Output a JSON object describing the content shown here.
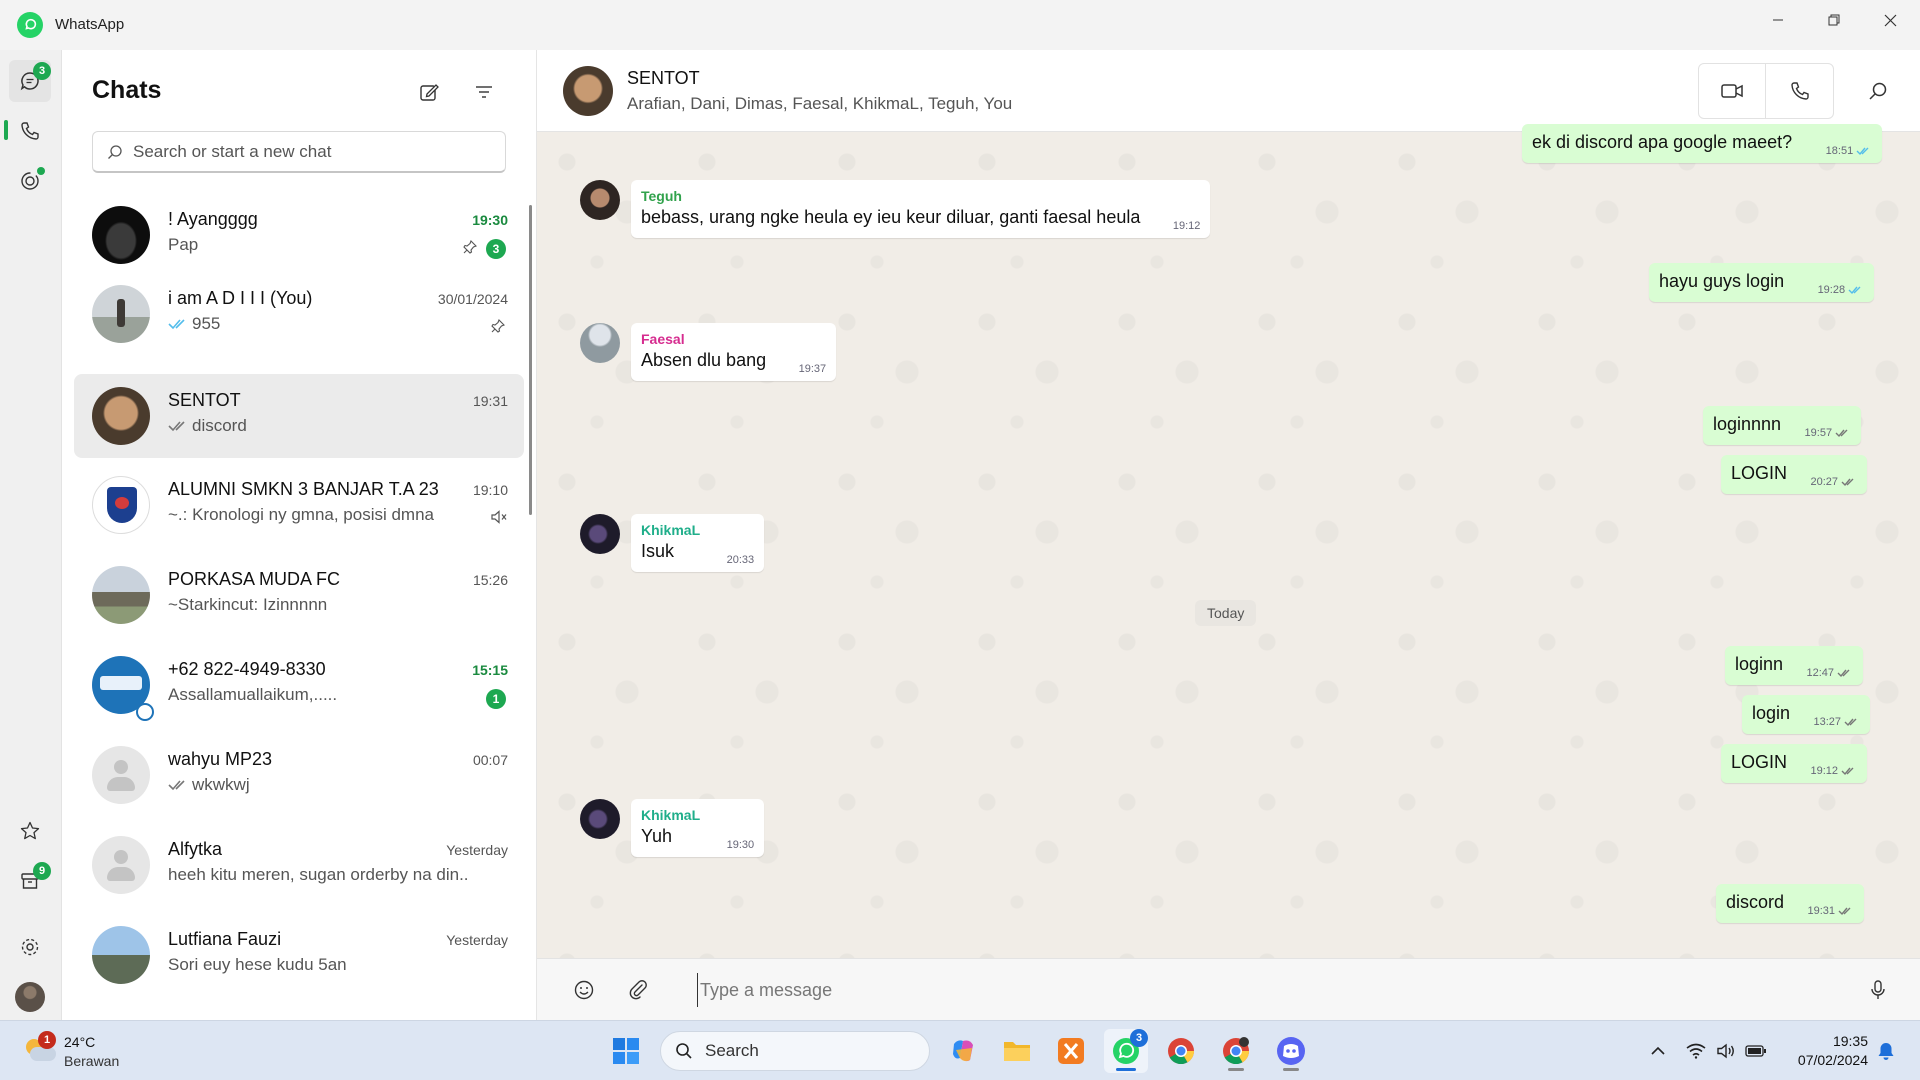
{
  "window": {
    "title": "WhatsApp"
  },
  "rail": {
    "chats_badge": "3",
    "archive_badge": "9"
  },
  "chatlist": {
    "title": "Chats",
    "search_placeholder": "Search or start a new chat",
    "items": [
      {
        "name": "! Ayangggg",
        "preview": "Pap",
        "time": "19:30",
        "unread": "3",
        "pinned": true,
        "ticks": false
      },
      {
        "name": "i am A D I I I (You)",
        "preview": "955",
        "time": "30/01/2024",
        "pinned": true,
        "ticks": "blue"
      },
      {
        "name": "SENTOT",
        "preview": "discord",
        "time": "19:31",
        "ticks": "grey",
        "selected": true
      },
      {
        "name": "ALUMNI SMKN 3 BANJAR T.A 23",
        "preview": "~.: Kronologi ny gmna, posisi dmna",
        "time": "19:10",
        "muted": true
      },
      {
        "name": "PORKASA MUDA FC",
        "preview": "~Starkincut: Izinnnnn",
        "time": "15:26"
      },
      {
        "name": "+62 822-4949-8330",
        "preview": "Assallamuallaikum,.....",
        "time": "15:15",
        "unread": "1"
      },
      {
        "name": "wahyu MP23",
        "preview": "wkwkwj",
        "time": "00:07",
        "ticks": "grey"
      },
      {
        "name": "Alfytka",
        "preview": "heeh kitu meren, sugan orderby na din...",
        "time": "Yesterday"
      },
      {
        "name": "Lutfiana Fauzi",
        "preview": "Sori euy hese kudu 5an",
        "time": "Yesterday"
      }
    ]
  },
  "conversation": {
    "name": "SENTOT",
    "members": "Arafian, Dani, Dimas, Faesal, KhikmaL, Teguh, You",
    "day_separator": "Today",
    "composer_placeholder": "Type a message",
    "messages": [
      {
        "dir": "out",
        "text": "ek di discord apa google maeet?",
        "time": "18:51",
        "read": true
      },
      {
        "dir": "in",
        "sender": "Teguh",
        "sender_color": "#31a24c",
        "text": "bebass, urang ngke heula ey ieu keur diluar, ganti faesal heula",
        "time": "19:12"
      },
      {
        "dir": "out",
        "text": "hayu guys login",
        "time": "19:28",
        "read": true
      },
      {
        "dir": "in",
        "sender": "Faesal",
        "sender_color": "#d62c8f",
        "text": "Absen dlu bang",
        "time": "19:37"
      },
      {
        "dir": "out",
        "text": "loginnnn",
        "time": "19:57",
        "read": false
      },
      {
        "dir": "out",
        "text": "LOGIN",
        "time": "20:27",
        "read": false
      },
      {
        "dir": "in",
        "sender": "KhikmaL",
        "sender_color": "#1fae8a",
        "text": "Isuk",
        "time": "20:33"
      },
      {
        "dir": "out",
        "text": "loginn",
        "time": "12:47",
        "read": false
      },
      {
        "dir": "out",
        "text": "login",
        "time": "13:27",
        "read": false
      },
      {
        "dir": "out",
        "text": "LOGIN",
        "time": "19:12",
        "read": false
      },
      {
        "dir": "in",
        "sender": "KhikmaL",
        "sender_color": "#1fae8a",
        "text": "Yuh",
        "time": "19:30"
      },
      {
        "dir": "out",
        "text": "discord",
        "time": "19:31",
        "read": false
      }
    ]
  },
  "taskbar": {
    "weather_temp": "24°C",
    "weather_desc": "Berawan",
    "weather_badge": "1",
    "search_label": "Search",
    "whatsapp_badge": "3",
    "clock_time": "19:35",
    "clock_date": "07/02/2024"
  },
  "colors": {
    "accent": "#1da851",
    "outgoing_bubble": "#d9fdd3",
    "read_tick": "#53bdeb"
  }
}
